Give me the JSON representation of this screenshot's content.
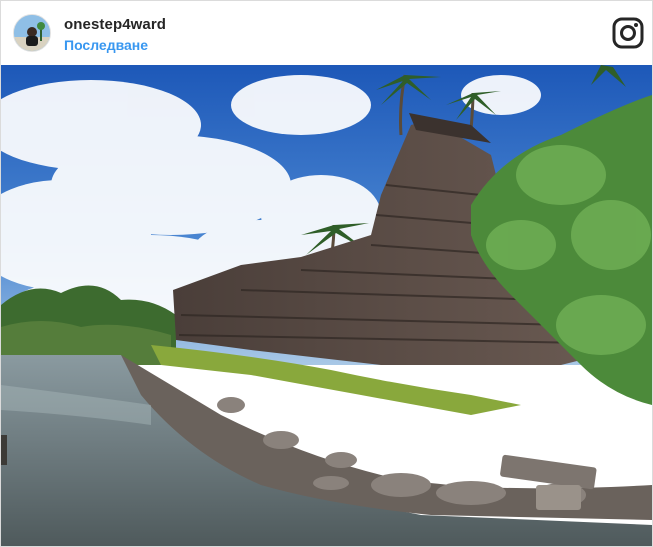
{
  "post": {
    "username": "onestep4ward",
    "follow_label": "Последване",
    "brand_icon": "instagram-icon",
    "photo_subject": "stone-ruins-by-water",
    "colors": {
      "link": "#3897f0",
      "username": "#262626",
      "border": "#dbdbdb",
      "sky": "#2f6fc4",
      "water": "#6f7f86"
    }
  }
}
